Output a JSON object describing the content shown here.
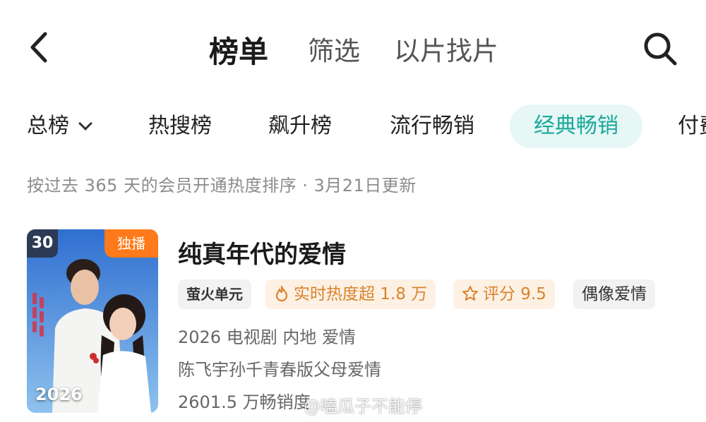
{
  "header": {
    "tabs": [
      {
        "label": "榜单",
        "active": true
      },
      {
        "label": "筛选",
        "active": false
      },
      {
        "label": "以片找片",
        "active": false
      }
    ]
  },
  "categories": [
    {
      "label": "总榜",
      "dropdown": true
    },
    {
      "label": "热搜榜"
    },
    {
      "label": "飙升榜"
    },
    {
      "label": "流行畅销"
    },
    {
      "label": "经典畅销",
      "active": true
    },
    {
      "label": "付费"
    }
  ],
  "subtitle": "按过去 365 天的会员开通热度排序 · 3月21日更新",
  "item": {
    "rank": "30",
    "badge": "独播",
    "poster_year": "2026",
    "title": "纯真年代的爱情",
    "brand_tag": "萤火单元",
    "hot_tag": "实时热度超 1.8 万",
    "score_tag": "评分 9.5",
    "genre_tag": "偶像爱情",
    "info_line": "2026 电视剧 内地 爱情",
    "desc_line": "陈飞宇孙千青春版父母爱情",
    "sales_line": "2601.5 万畅销度"
  },
  "watermark": "@嗑瓜子不能停",
  "colors": {
    "accent": "#1ba89a",
    "accent_bg": "#e6f7f5",
    "hot": "#d9832c",
    "badge": "#ff7a1a",
    "rank_bg": "#2d3a55"
  },
  "icons": [
    "back-arrow-icon",
    "search-icon",
    "chevron-down-icon",
    "flame-icon",
    "star-icon"
  ]
}
